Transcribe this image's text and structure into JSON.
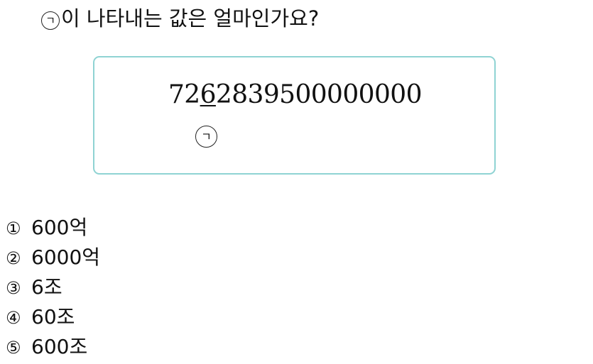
{
  "question": {
    "marker": "ㄱ",
    "text": "이 나타내는 값은 얼마인가요?"
  },
  "figure": {
    "number_before": "72",
    "number_target": "6",
    "number_after": "2839500000000",
    "marker": "ㄱ"
  },
  "choices": [
    {
      "num": "①",
      "label": "600억"
    },
    {
      "num": "②",
      "label": "6000억"
    },
    {
      "num": "③",
      "label": "6조"
    },
    {
      "num": "④",
      "label": "60조"
    },
    {
      "num": "⑤",
      "label": "600조"
    }
  ],
  "colors": {
    "box_border": "#8fd3d3",
    "text": "#111111"
  }
}
